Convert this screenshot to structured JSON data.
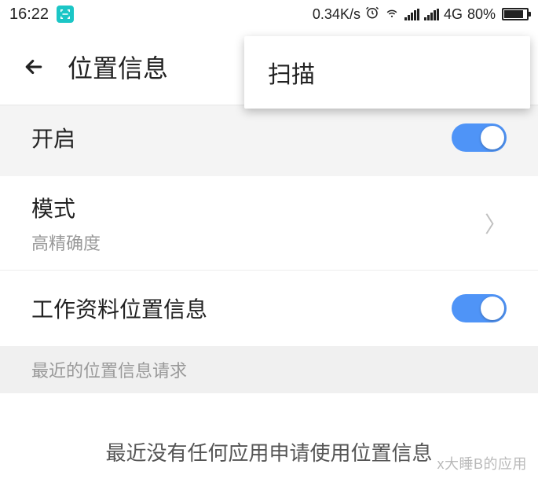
{
  "status": {
    "time": "16:22",
    "net_speed": "0.34K/s",
    "net_label": "4G",
    "battery_pct": "80%"
  },
  "header": {
    "title": "位置信息"
  },
  "dropdown": {
    "scan": "扫描"
  },
  "rows": {
    "enable_label": "开启",
    "mode_label": "模式",
    "mode_value": "高精确度",
    "work_label": "工作资料位置信息"
  },
  "section": {
    "recent_header": "最近的位置信息请求",
    "empty": "最近没有任何应用申请使用位置信息"
  },
  "watermark": "x大睡B的应用"
}
